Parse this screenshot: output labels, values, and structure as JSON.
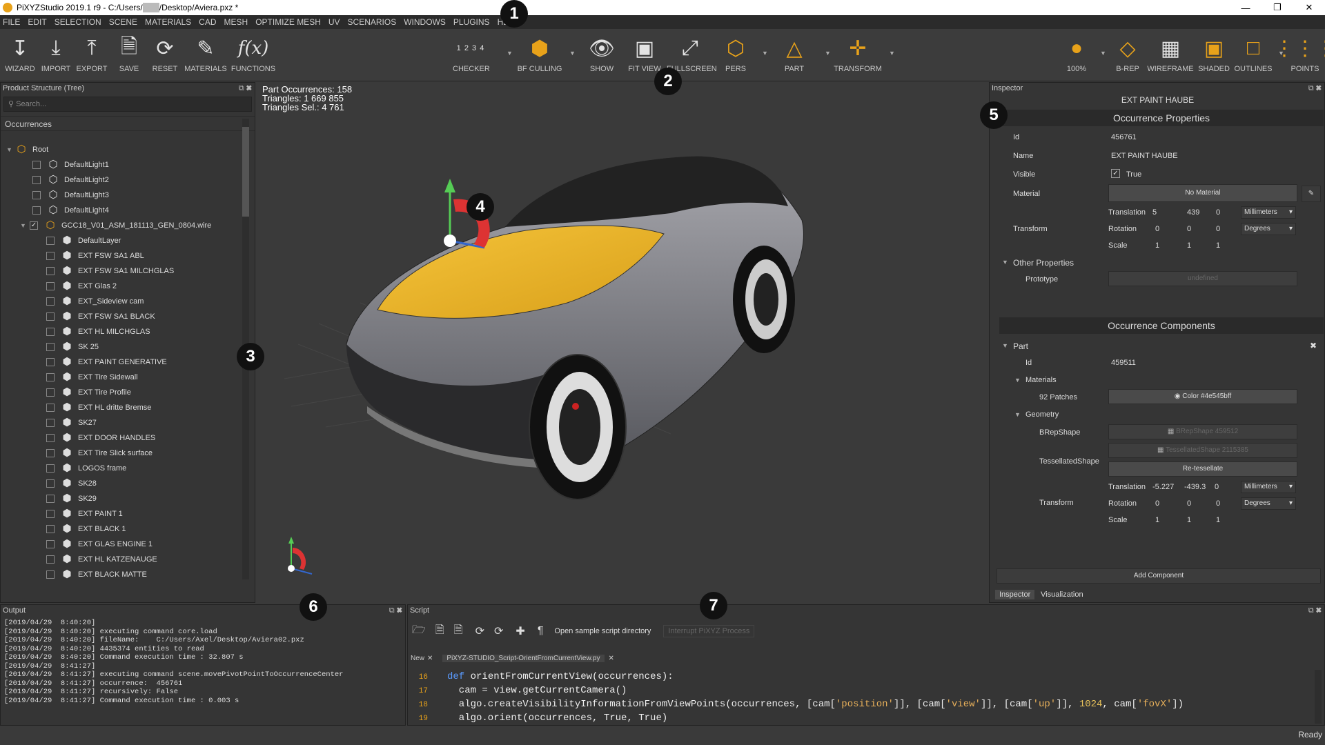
{
  "title": "PiXYZStudio 2019.1 r9 - C:/Users/",
  "title_tail": "/Desktop/Aviera.pxz *",
  "menu": [
    "FILE",
    "EDIT",
    "SELECTION",
    "SCENE",
    "MATERIALS",
    "CAD",
    "MESH",
    "OPTIMIZE MESH",
    "UV",
    "SCENARIOS",
    "WINDOWS",
    "PLUGINS",
    "HELP"
  ],
  "toolbar": {
    "wizard": "WIZARD",
    "import": "IMPORT",
    "export": "EXPORT",
    "save": "SAVE",
    "reset": "RESET",
    "materials": "MATERIALS",
    "functions": "FUNCTIONS",
    "checker": "CHECKER",
    "checker_icon": "1 2 3 4",
    "bfculling": "BF CULLING",
    "show": "SHOW",
    "fitview": "FIT VIEW",
    "fullscreen": "FULLSCREEN",
    "pers": "PERS",
    "part": "PART",
    "transform": "TRANSFORM",
    "zoom": "100%",
    "brep": "B-REP",
    "wireframe": "WIREFRAME",
    "shaded": "SHADED",
    "outlines": "OUTLINES",
    "points": "POINTS",
    "functions_icon": "f(x)"
  },
  "badges": [
    "1",
    "2",
    "3",
    "4",
    "5",
    "6",
    "7"
  ],
  "tree": {
    "header": "Product Structure (Tree)",
    "search": "Search...",
    "occurrences": "Occurrences",
    "items": [
      "Root",
      "DefaultLight1",
      "DefaultLight2",
      "DefaultLight3",
      "DefaultLight4",
      "GCC18_V01_ASM_181113_GEN_0804.wire",
      "DefaultLayer",
      "EXT FSW SA1 ABL",
      "EXT FSW SA1 MILCHGLAS",
      "EXT Glas 2",
      "EXT_Sideview cam",
      "EXT FSW SA1 BLACK",
      "EXT HL MILCHGLAS",
      "SK 25",
      "EXT PAINT GENERATIVE",
      "EXT Tire Sidewall",
      "EXT Tire Profile",
      "EXT HL dritte Bremse",
      "SK27",
      "EXT DOOR HANDLES",
      "EXT Tire Slick surface",
      "LOGOS frame",
      "SK28",
      "SK29",
      "EXT PAINT 1",
      "EXT BLACK 1",
      "EXT GLAS ENGINE 1",
      "EXT HL KATZENAUGE",
      "EXT BLACK MATTE"
    ]
  },
  "viewport": {
    "stats": [
      "Part Occurrences: 158",
      "Triangles: 1 669 855",
      "Triangles Sel.: 4 761"
    ]
  },
  "inspector": {
    "header": "Inspector",
    "name_title": "EXT PAINT HAUBE",
    "occ_props": "Occurrence Properties",
    "id_label": "Id",
    "id_value": "456761",
    "name_label": "Name",
    "name_value": "EXT PAINT HAUBE",
    "visible_label": "Visible",
    "visible_value": "True",
    "material_label": "Material",
    "material_value": "No Material",
    "transform_label": "Transform",
    "translation_label": "Translation",
    "translation": [
      "5",
      "439",
      "0"
    ],
    "rotation_label": "Rotation",
    "rotation": [
      "0",
      "0",
      "0"
    ],
    "scale_label": "Scale",
    "scale": [
      "1",
      "1",
      "1"
    ],
    "unit_mm": "Millimeters",
    "unit_deg": "Degrees",
    "other_props": "Other Properties",
    "prototype_label": "Prototype",
    "prototype_value": "undefined",
    "occ_components": "Occurrence Components",
    "part_label": "Part",
    "part_id_label": "Id",
    "part_id_value": "459511",
    "materials_label": "Materials",
    "patches_label": "92 Patches",
    "patches_value": "Color #4e545bff",
    "geometry_label": "Geometry",
    "brep_label": "BRepShape",
    "brep_value": "BRepShape 459512",
    "tess_label": "TessellatedShape",
    "tess_value": "TessellatedShape 2115385",
    "retess": "Re-tessellate",
    "translation2": [
      "-5.227",
      "-439.3",
      "0"
    ],
    "rotation2": [
      "0",
      "0",
      "0"
    ],
    "scale2": [
      "1",
      "1",
      "1"
    ],
    "add_component": "Add Component",
    "tab_inspector": "Inspector",
    "tab_visualization": "Visualization"
  },
  "output": {
    "header": "Output",
    "lines": [
      "[2019/04/29  8:40:20]",
      "[2019/04/29  8:40:20] executing command core.load",
      "[2019/04/29  8:40:20] fileName:    C:/Users/Axel/Desktop/Aviera02.pxz",
      "[2019/04/29  8:40:20] 4435374 entities to read",
      "[2019/04/29  8:40:20] Command execution time : 32.807 s",
      "[2019/04/29  8:41:27]",
      "[2019/04/29  8:41:27] executing command scene.movePivotPointToOccurrenceCenter",
      "[2019/04/29  8:41:27] occurrence:  456761",
      "[2019/04/29  8:41:27] recursively: False",
      "[2019/04/29  8:41:27] Command execution time : 0.003 s"
    ]
  },
  "script": {
    "header": "Script",
    "open_sample": "Open sample script directory",
    "interrupt": "Interrupt PiXYZ Process",
    "tab_new": "New",
    "tab_file": "PiXYZ-STUDIO_Script-OrientFromCurrentView.py",
    "line_numbers": [
      "16",
      "17",
      "18",
      "19"
    ],
    "l16_kw": "def",
    "l16_rest": " orientFromCurrentView(occurrences):",
    "l17": "  cam = view.getCurrentCamera()",
    "l18a": "  algo.createVisibilityInformationFromViewPoints(occurrences, [cam[",
    "l18b": "'position'",
    "l18c": "]], [cam[",
    "l18d": "'view'",
    "l18e": "]], [cam[",
    "l18f": "'up'",
    "l18g": "]], ",
    "l18h": "1024",
    "l18i": ", cam[",
    "l18j": "'fovX'",
    "l18k": "])",
    "l19": "  algo.orient(occurrences, True, True)"
  },
  "status": "Ready"
}
